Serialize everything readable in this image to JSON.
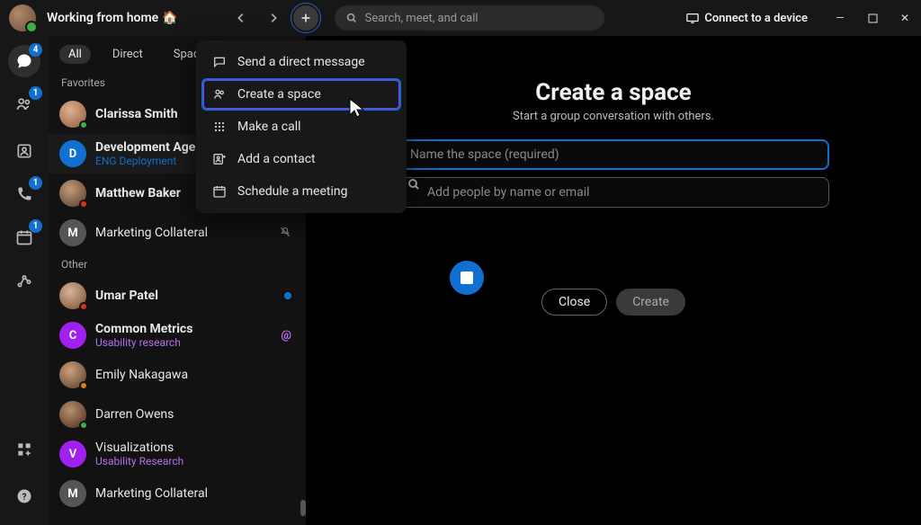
{
  "header": {
    "status_text": "Working from home",
    "status_emoji": "🏠",
    "search_placeholder": "Search, meet, and call",
    "connect_label": "Connect to a device"
  },
  "rail": {
    "badges": {
      "chat": "4",
      "people": "1",
      "calls": "1",
      "calendar": "1"
    }
  },
  "tabs": {
    "all": "All",
    "direct": "Direct",
    "spaces": "Spaces"
  },
  "sidebar": {
    "section_favorites": "Favorites",
    "section_other": "Other",
    "favorites": [
      {
        "name": "Clarissa Smith"
      },
      {
        "name": "Development Agenc",
        "sub": "ENG Deployment",
        "letter": "D"
      },
      {
        "name": "Matthew Baker"
      },
      {
        "name": "Marketing Collateral",
        "letter": "M"
      }
    ],
    "other": [
      {
        "name": "Umar Patel"
      },
      {
        "name": "Common Metrics",
        "sub": "Usability research",
        "letter": "C"
      },
      {
        "name": "Emily Nakagawa"
      },
      {
        "name": "Darren Owens"
      },
      {
        "name": "Visualizations",
        "sub": "Usability Research",
        "letter": "V"
      },
      {
        "name": "Marketing Collateral",
        "letter": "M"
      }
    ]
  },
  "dropdown": {
    "items": [
      "Send a direct message",
      "Create a space",
      "Make a call",
      "Add a contact",
      "Schedule a meeting"
    ]
  },
  "panel": {
    "title": "Create a space",
    "subtitle": "Start a group conversation with others.",
    "name_placeholder": "Name the space (required)",
    "people_placeholder": "Add people by name or email",
    "close": "Close",
    "create": "Create"
  }
}
